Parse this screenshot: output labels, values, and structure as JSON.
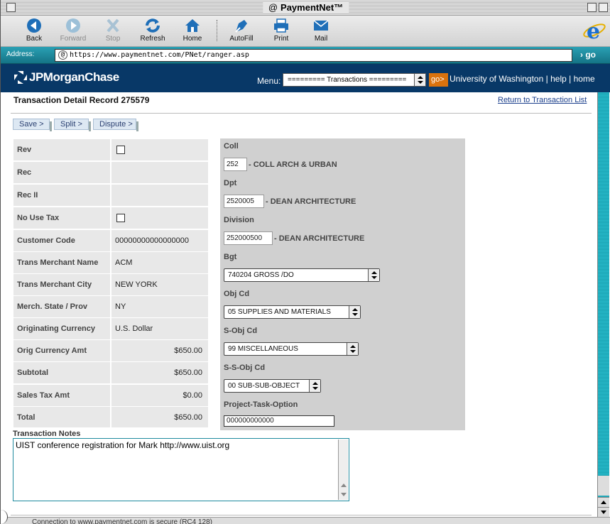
{
  "window": {
    "title": "PaymentNet™"
  },
  "toolbar": {
    "back": "Back",
    "forward": "Forward",
    "stop": "Stop",
    "refresh": "Refresh",
    "home": "Home",
    "autofill": "AutoFill",
    "print": "Print",
    "mail": "Mail"
  },
  "address": {
    "label": "Address:",
    "url": "https://www.paymentnet.com/PNet/ranger.asp",
    "go": "go"
  },
  "header": {
    "logo": "JPMorganChase",
    "menu_label": "Menu:",
    "menu_value": "========= Transactions =========",
    "go": "go>",
    "org": "University of Washington",
    "sep": "|",
    "help": "help",
    "home": "home"
  },
  "page": {
    "title": "Transaction Detail Record 275579",
    "return_link": "Return to Transaction List"
  },
  "actions": {
    "save": "Save >",
    "split": "Split >",
    "dispute": "Dispute >"
  },
  "detail": [
    {
      "label": "Rev",
      "value": ""
    },
    {
      "label": "Rec",
      "value": ""
    },
    {
      "label": "Rec II",
      "value": ""
    },
    {
      "label": "No Use Tax",
      "value": ""
    },
    {
      "label": "Customer Code",
      "value": "00000000000000000"
    },
    {
      "label": "Trans Merchant Name",
      "value": "ACM"
    },
    {
      "label": "Trans Merchant City",
      "value": "NEW YORK"
    },
    {
      "label": "Merch. State / Prov",
      "value": "NY"
    },
    {
      "label": "Originating Currency",
      "value": "U.S. Dollar"
    },
    {
      "label": "Orig Currency Amt",
      "value": "$650.00"
    },
    {
      "label": "Subtotal",
      "value": "$650.00"
    },
    {
      "label": "Sales Tax Amt",
      "value": "$0.00"
    },
    {
      "label": "Total",
      "value": "$650.00"
    }
  ],
  "coding": {
    "coll_label": "Coll",
    "coll_value": "252",
    "coll_desc": "- COLL ARCH & URBAN",
    "dpt_label": "Dpt",
    "dpt_value": "2520005",
    "dpt_desc": "- DEAN ARCHITECTURE",
    "division_label": "Division",
    "division_value": "252000500",
    "division_desc": "- DEAN ARCHITECTURE",
    "bgt_label": "Bgt",
    "bgt_value": "740204 GROSS /DO",
    "objcd_label": "Obj Cd",
    "objcd_value": "05 SUPPLIES AND MATERIALS",
    "sobjcd_label": "S-Obj Cd",
    "sobjcd_value": "99 MISCELLANEOUS",
    "ssobjcd_label": "S-S-Obj Cd",
    "ssobjcd_value": "00 SUB-SUB-OBJECT",
    "pto_label": "Project-Task-Option",
    "pto_value": "000000000000"
  },
  "notes": {
    "label": "Transaction Notes",
    "value": "UIST conference registration for Mark http://www.uist.org"
  },
  "status": {
    "text": "Connection to www.paymentnet.com is secure (RC4 128)"
  }
}
